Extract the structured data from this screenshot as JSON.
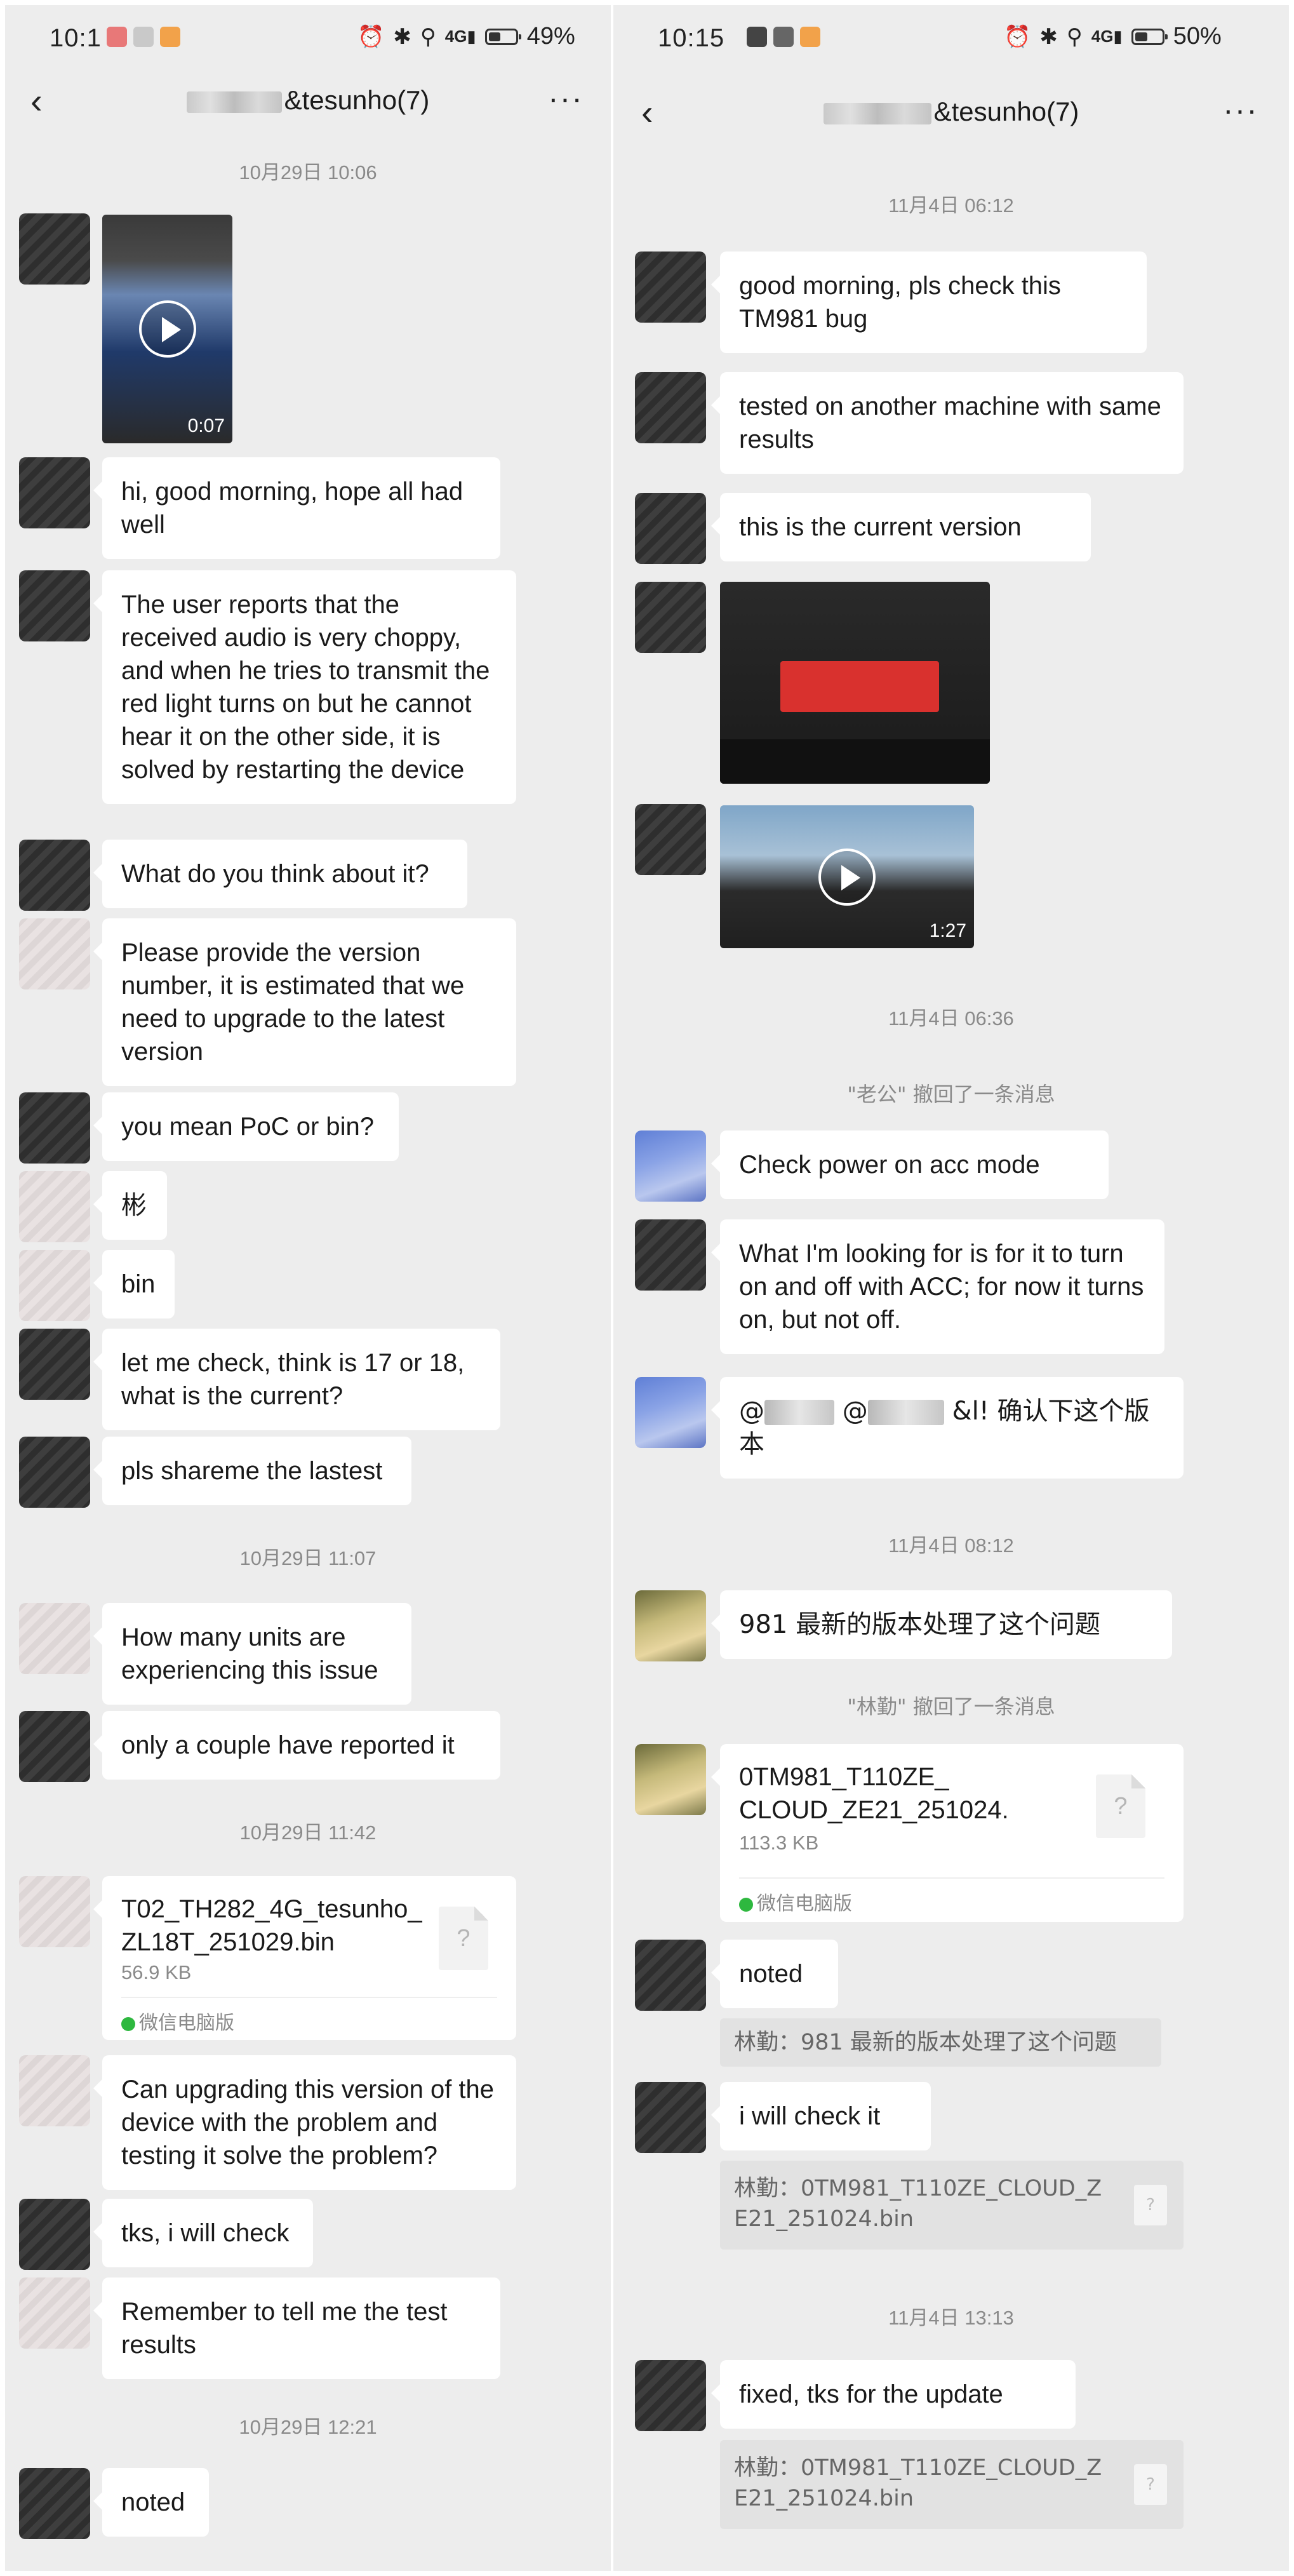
{
  "left": {
    "status": {
      "time": "10:1",
      "battery_text": "49%",
      "battery_level": 0.49
    },
    "nav": {
      "title": "&tesunho(7)"
    },
    "messages": [
      {
        "type": "timestamp",
        "text": "10月29日 10:06"
      },
      {
        "type": "video",
        "duration": "0:07",
        "avatar": "dark"
      },
      {
        "type": "text",
        "avatar": "dark",
        "text": "hi, good morning, hope all had well"
      },
      {
        "type": "text",
        "avatar": "dark",
        "text": "The user reports that the received audio is very choppy, and when he tries to transmit the red light turns on but he cannot hear it on the other side, it is solved by restarting the device"
      },
      {
        "type": "text",
        "avatar": "dark",
        "text": "What do you think about it?"
      },
      {
        "type": "text",
        "avatar": "light",
        "text": "Please provide the version number, it is estimated that we need to upgrade to the latest version"
      },
      {
        "type": "text",
        "avatar": "dark",
        "text": "you mean PoC or bin?"
      },
      {
        "type": "text",
        "avatar": "light",
        "text": "彬"
      },
      {
        "type": "text",
        "avatar": "light",
        "text": "bin"
      },
      {
        "type": "text",
        "avatar": "dark",
        "text": "let me check, think is 17 or 18, what is the current?"
      },
      {
        "type": "text",
        "avatar": "dark",
        "text": "pls shareme the lastest"
      },
      {
        "type": "timestamp",
        "text": "10月29日 11:07"
      },
      {
        "type": "text",
        "avatar": "light",
        "text": "How many units are experiencing this issue"
      },
      {
        "type": "text",
        "avatar": "dark",
        "text": "only a couple have reported it"
      },
      {
        "type": "timestamp",
        "text": "10月29日 11:42"
      },
      {
        "type": "file",
        "avatar": "light",
        "name_line1": "T02_TH282_4G_tesunho_",
        "name_line2": "ZL18T_251029.bin",
        "size": "56.9 KB",
        "source": "微信电脑版"
      },
      {
        "type": "text",
        "avatar": "light",
        "text": "Can upgrading this version of the device with the problem and testing it solve the problem?"
      },
      {
        "type": "text",
        "avatar": "dark",
        "text": "tks, i will check"
      },
      {
        "type": "text",
        "avatar": "light",
        "text": "Remember to tell me the test results"
      },
      {
        "type": "timestamp",
        "text": "10月29日 12:21"
      },
      {
        "type": "text",
        "avatar": "dark",
        "text": "noted"
      }
    ]
  },
  "right": {
    "status": {
      "time": "10:15",
      "battery_text": "50%",
      "battery_level": 0.5
    },
    "nav": {
      "title": "&tesunho(7)"
    },
    "messages": [
      {
        "type": "timestamp",
        "text": "11月4日 06:12"
      },
      {
        "type": "text",
        "avatar": "dark",
        "text": "good morning, pls check this TM981 bug"
      },
      {
        "type": "text",
        "avatar": "dark",
        "text": "tested on another machine with same results"
      },
      {
        "type": "text",
        "avatar": "dark",
        "text": "this is the current version"
      },
      {
        "type": "image",
        "avatar": "dark"
      },
      {
        "type": "video",
        "avatar": "dark",
        "duration": "1:27"
      },
      {
        "type": "timestamp",
        "text": "11月4日 06:36"
      },
      {
        "type": "recall",
        "text": "\"老公\" 撤回了一条消息"
      },
      {
        "type": "text",
        "avatar": "blue",
        "text": "Check power on acc mode"
      },
      {
        "type": "text",
        "avatar": "dark",
        "text": "What I'm looking for is for it to turn on and off with ACC; for now it turns on, but not off."
      },
      {
        "type": "text",
        "avatar": "blue",
        "text_a": "@",
        "text_b": "@",
        "text_c": "&l! 确认下这个版本"
      },
      {
        "type": "timestamp",
        "text": "11月4日 08:12"
      },
      {
        "type": "text",
        "avatar": "yellow",
        "text": "981  最新的版本处理了这个问题"
      },
      {
        "type": "recall",
        "text": "\"林勤\" 撤回了一条消息"
      },
      {
        "type": "file",
        "avatar": "yellow",
        "name_line1": "0TM981_T110ZE_",
        "name_line2": "CLOUD_ZE21_251024.",
        "size": "113.3 KB",
        "source": "微信电脑版"
      },
      {
        "type": "text",
        "avatar": "dark",
        "text": "noted"
      },
      {
        "type": "quote",
        "text": "林勤：981  最新的版本处理了这个问题"
      },
      {
        "type": "text",
        "avatar": "dark",
        "text": "i will check it"
      },
      {
        "type": "quote",
        "line1": "林勤：0TM981_T110ZE_CLOUD_Z",
        "line2": "E21_251024.bin"
      },
      {
        "type": "timestamp",
        "text": "11月4日 13:13"
      },
      {
        "type": "text",
        "avatar": "dark",
        "text": "fixed, tks for the update"
      },
      {
        "type": "quote",
        "line1": "林勤：0TM981_T110ZE_CLOUD_Z",
        "line2": "E21_251024.bin"
      }
    ]
  },
  "icons": {
    "back": "chevron-left-icon",
    "more": "more-dots-icon",
    "play": "play-icon",
    "file": "file-unknown-icon"
  },
  "colors": {
    "chat_bg": "#ededed",
    "bubble": "#ffffff",
    "timestamp": "#8a8a8a",
    "quote_bg": "#e2e2e2",
    "wechat_green": "#2eb83f"
  }
}
